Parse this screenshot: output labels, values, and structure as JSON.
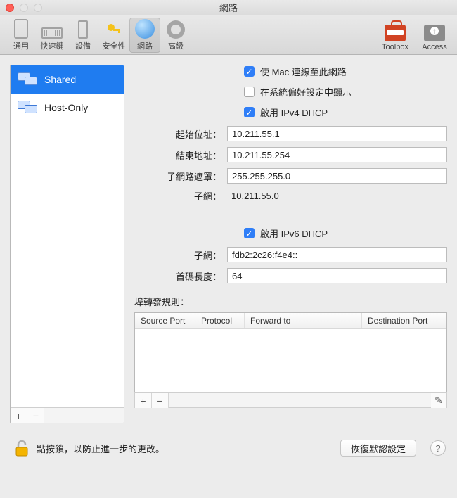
{
  "window": {
    "title": "網路"
  },
  "toolbar": {
    "items": [
      {
        "id": "general",
        "label": "通用"
      },
      {
        "id": "hotkeys",
        "label": "快速鍵"
      },
      {
        "id": "devices",
        "label": "設備"
      },
      {
        "id": "security",
        "label": "安全性"
      },
      {
        "id": "network",
        "label": "網路",
        "selected": true
      },
      {
        "id": "advanced",
        "label": "高級"
      }
    ],
    "right": [
      {
        "id": "toolbox",
        "label": "Toolbox"
      },
      {
        "id": "access",
        "label": "Access"
      }
    ]
  },
  "sidebar": {
    "items": [
      {
        "label": "Shared",
        "selected": true
      },
      {
        "label": "Host-Only",
        "selected": false
      }
    ]
  },
  "form": {
    "connect_mac": {
      "label": "使 Mac 連線至此網路",
      "checked": true
    },
    "show_in_sysprefs": {
      "label": "在系統偏好設定中顯示",
      "checked": false
    },
    "ipv4_dhcp": {
      "label": "啟用 IPv4 DHCP",
      "checked": true
    },
    "start_addr": {
      "label": "起始位址：",
      "value": "10.211.55.1"
    },
    "end_addr": {
      "label": "結束地址：",
      "value": "10.211.55.254"
    },
    "subnet_mask": {
      "label": "子網路遮罩：",
      "value": "255.255.255.0"
    },
    "subnet": {
      "label": "子網：",
      "value": "10.211.55.0"
    },
    "ipv6_dhcp": {
      "label": "啟用 IPv6 DHCP",
      "checked": true
    },
    "ipv6_subnet": {
      "label": "子網：",
      "value": "fdb2:2c26:f4e4::"
    },
    "prefix_len": {
      "label": "首碼長度：",
      "value": "64"
    }
  },
  "rules": {
    "label": "埠轉發規則：",
    "columns": {
      "source_port": "Source Port",
      "protocol": "Protocol",
      "forward_to": "Forward to",
      "dest_port": "Destination Port"
    }
  },
  "footer": {
    "lock_text": "點按鎖，以防止進一步的更改。",
    "restore": "恢復默認設定"
  },
  "glyphs": {
    "plus": "+",
    "minus": "−",
    "pencil": "✎",
    "help": "?"
  }
}
